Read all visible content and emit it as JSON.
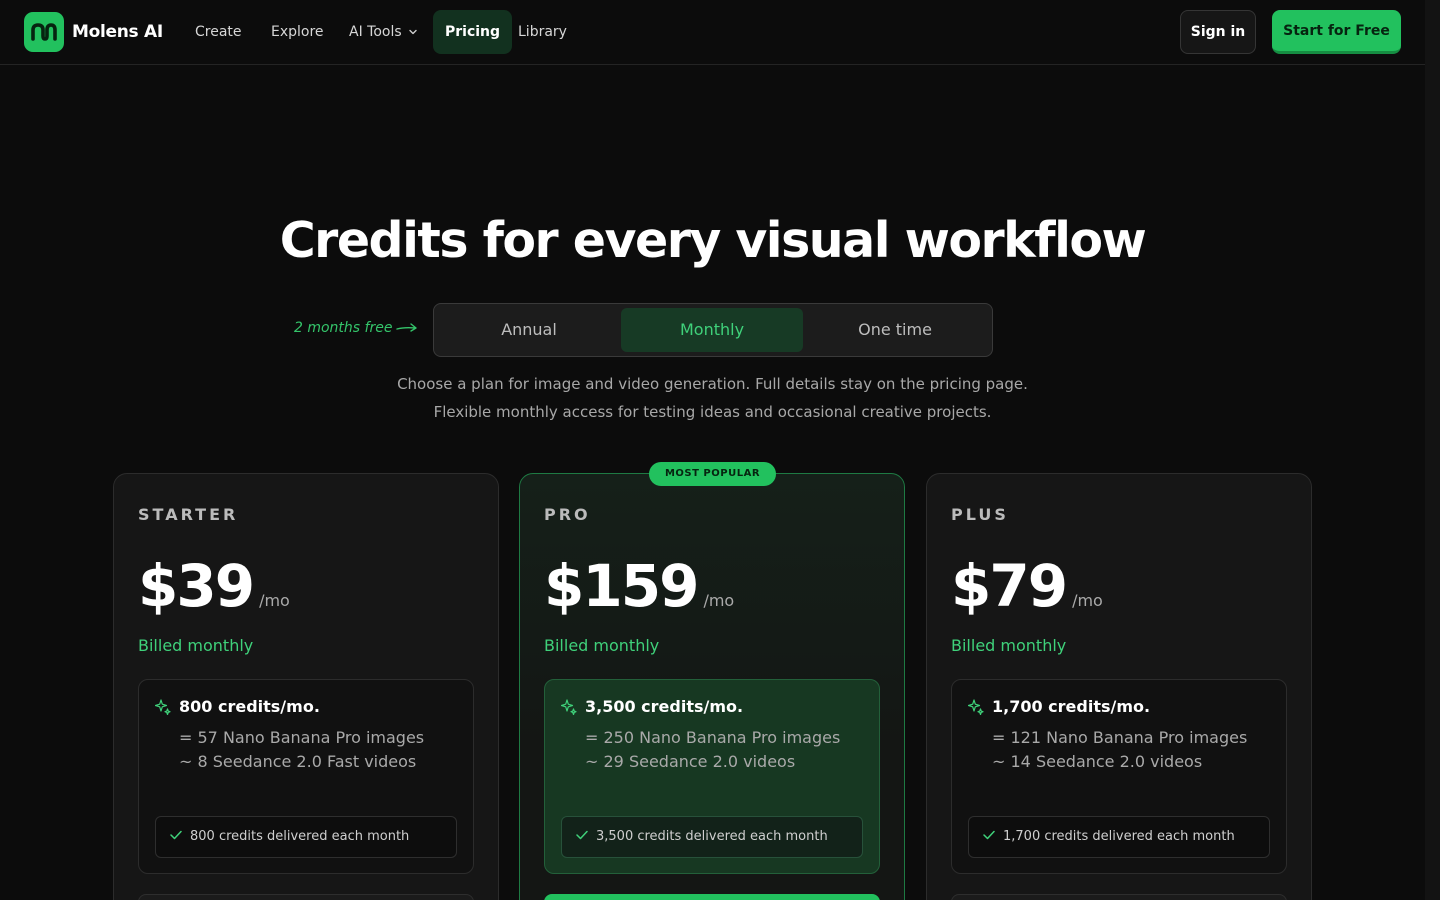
{
  "nav": {
    "brand": "Molens AI",
    "links": [
      {
        "label": "Create"
      },
      {
        "label": "Explore"
      },
      {
        "label": "AI Tools"
      },
      {
        "label": "Pricing"
      },
      {
        "label": "Library"
      }
    ],
    "signin": "Sign in",
    "start": "Start for Free"
  },
  "hero": {
    "headline": "Credits for every visual workflow",
    "promo": "2 months free",
    "toggle": [
      "Annual",
      "Monthly",
      "One time"
    ],
    "selected_toggle": "Monthly",
    "sub1": "Choose a plan for image and video generation. Full details stay on the pricing page.",
    "sub2": "Flexible monthly access for testing ideas and occasional creative projects."
  },
  "badge": "MOST POPULAR",
  "plans": [
    {
      "tier": "STARTER",
      "price": "$39",
      "per": "/mo",
      "billed": "Billed monthly",
      "credits": "800 credits/mo.",
      "line1": "= 57 Nano Banana Pro images",
      "line2": "~ 8 Seedance 2.0 Fast videos",
      "deliver": "800 credits delivered each month"
    },
    {
      "tier": "PRO",
      "price": "$159",
      "per": "/mo",
      "billed": "Billed monthly",
      "credits": "3,500 credits/mo.",
      "line1": "= 250 Nano Banana Pro images",
      "line2": "~ 29 Seedance 2.0 videos",
      "deliver": "3,500 credits delivered each month"
    },
    {
      "tier": "PLUS",
      "price": "$79",
      "per": "/mo",
      "billed": "Billed monthly",
      "credits": "1,700 credits/mo.",
      "line1": "= 121 Nano Banana Pro images",
      "line2": "~ 14 Seedance 2.0 videos",
      "deliver": "1,700 credits delivered each month"
    }
  ],
  "colors": {
    "accent": "#22c15e",
    "accent_text": "#3fd17a",
    "background": "#0c0c0c"
  },
  "icons": [
    "logo-icon",
    "chevron-down-icon",
    "arrow-right-icon",
    "sparkle-icon",
    "check-icon"
  ]
}
